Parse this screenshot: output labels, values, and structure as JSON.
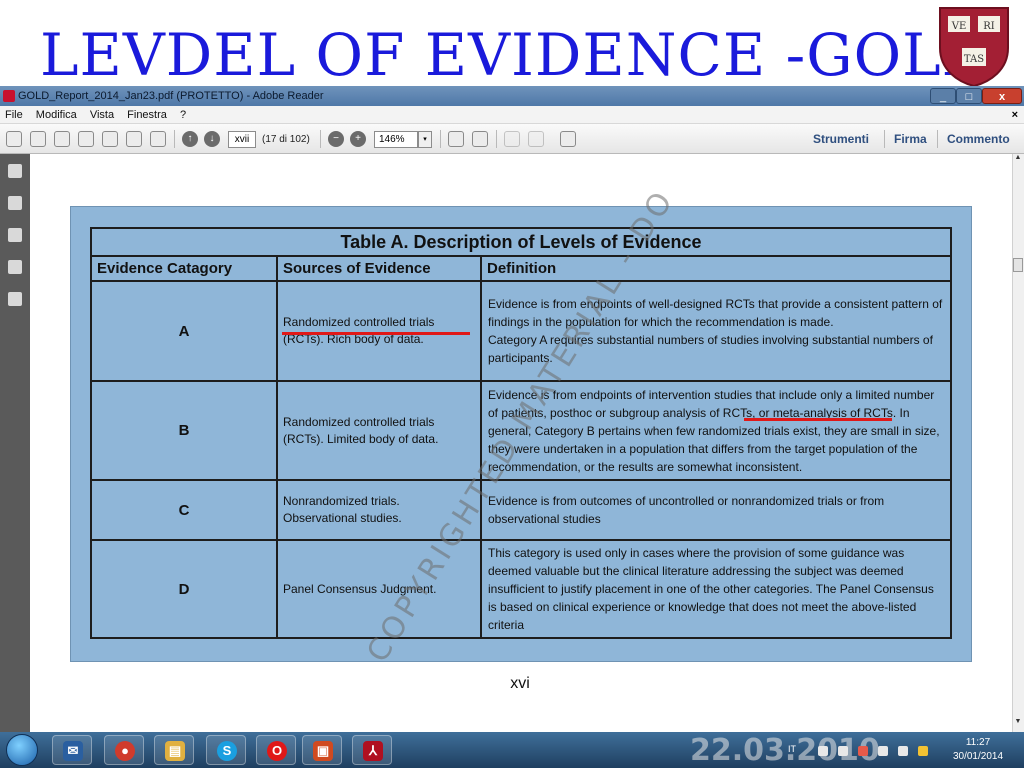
{
  "slide": {
    "title": "LEVDEL OF EVIDENCE -GOLD",
    "crest": {
      "top_left": "VE",
      "top_right": "RI",
      "bottom": "TAS",
      "color": "#a31f34"
    }
  },
  "window": {
    "title": "GOLD_Report_2014_Jan23.pdf (PROTETTO) - Adobe Reader",
    "buttons": {
      "minimize": "_",
      "maximize": "□",
      "close": "x"
    }
  },
  "menubar": {
    "items": [
      "File",
      "Modifica",
      "Vista",
      "Finestra",
      "?"
    ],
    "close_doc": "×"
  },
  "toolbar": {
    "page_field": "xvii",
    "page_count": "(17 di 102)",
    "zoom": "146%",
    "zoom_dropdown": "▾",
    "zoom_out": "−",
    "zoom_in": "+",
    "prev_page": "↑",
    "next_page": "↓",
    "links": {
      "tools": "Strumenti",
      "sign": "Firma",
      "comment": "Commento"
    }
  },
  "document": {
    "table": {
      "caption": "Table A. Description of Levels of Evidence",
      "headers": [
        "Evidence Catagory",
        "Sources of Evidence",
        "Definition"
      ],
      "rows": [
        {
          "category": "A",
          "sources": "Randomized controlled trials (RCTs). Rich body of data.",
          "definition": "Evidence is from endpoints of well-designed RCTs that provide a consistent pattern of findings in the population for which the recommendation is made.\nCategory A requires substantial numbers of studies involving substantial numbers of participants."
        },
        {
          "category": "B",
          "sources": "Randomized controlled trials (RCTs). Limited body of data.",
          "definition": "Evidence is from endpoints of intervention studies that include only a limited number of patients, posthoc or subgroup analysis of RCTs, or meta-analysis of RCTs. In general, Category B pertains when few randomized trials exist, they are small in size, they were undertaken in a population that differs from the target population of the recommendation, or the results are somewhat inconsistent."
        },
        {
          "category": "C",
          "sources": "Nonrandomized trials. Observational studies.",
          "definition": "Evidence is from outcomes of uncontrolled or nonrandomized trials or from observational studies"
        },
        {
          "category": "D",
          "sources": "Panel Consensus Judgment.",
          "definition": "This category is used only in cases where the provision of some guidance was deemed valuable but the clinical literature addressing the subject was deemed insufficient to justify placement in one of the other categories. The Panel Consensus is based on clinical experience or knowledge that does not meet the above-listed criteria"
        }
      ]
    },
    "watermark": "COPYRIGHTED MATERIAL - DO",
    "page_number": "xvi",
    "annotation_color": "#e01818"
  },
  "taskbar": {
    "apps": [
      {
        "name": "thunderbird",
        "glyph": "✉",
        "color": "#2a5fa0"
      },
      {
        "name": "chrome",
        "glyph": "●",
        "color": "#d03b2c"
      },
      {
        "name": "explorer",
        "glyph": "▤",
        "color": "#e0b040"
      },
      {
        "name": "skype",
        "glyph": "S",
        "color": "#1a9fe0"
      },
      {
        "name": "vodafone",
        "glyph": "O",
        "color": "#e01818"
      },
      {
        "name": "presentation",
        "glyph": "▣",
        "color": "#d04a20"
      },
      {
        "name": "acrobat",
        "glyph": "⅄",
        "color": "#b01020"
      }
    ],
    "background_text": "22.03.2010",
    "tray": {
      "language": "IT",
      "time": "11:27",
      "date": "30/01/2014"
    }
  }
}
